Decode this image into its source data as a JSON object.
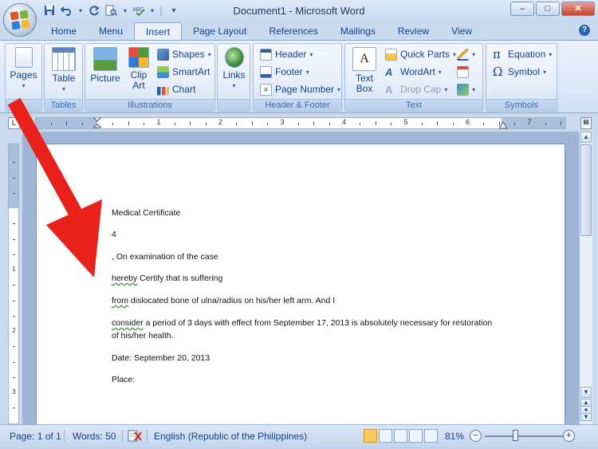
{
  "window": {
    "title": "Document1 - Microsoft Word",
    "controls": {
      "minimize": "–",
      "maximize": "□",
      "close": "✕"
    }
  },
  "quick_access": [
    {
      "name": "save-icon",
      "glyph": "💾"
    },
    {
      "name": "undo-icon",
      "glyph": "↶"
    },
    {
      "name": "redo-icon",
      "glyph": "↻"
    },
    {
      "name": "print-preview-icon",
      "glyph": "▤"
    },
    {
      "name": "spelling-icon",
      "glyph": "✓"
    },
    {
      "name": "customize-icon",
      "glyph": "▾"
    }
  ],
  "tabs": [
    "Home",
    "Menu",
    "Insert",
    "Page Layout",
    "References",
    "Mailings",
    "Review",
    "View"
  ],
  "active_tab": "Insert",
  "help_label": "?",
  "ribbon": {
    "pages": {
      "label": "Pages",
      "group": ""
    },
    "tables": {
      "table": "Table",
      "group": "Tables"
    },
    "illustrations": {
      "picture": "Picture",
      "clip_art_line1": "Clip",
      "clip_art_line2": "Art",
      "shapes": "Shapes",
      "smartart": "SmartArt",
      "chart": "Chart",
      "group": "Illustrations"
    },
    "links": {
      "label": "Links",
      "group": ""
    },
    "header_footer": {
      "header": "Header",
      "footer": "Footer",
      "page_number": "Page Number",
      "group": "Header & Footer"
    },
    "text": {
      "text_box_line1": "Text",
      "text_box_line2": "Box",
      "quick_parts": "Quick Parts",
      "wordart": "WordArt",
      "drop_cap": "Drop Cap",
      "group": "Text"
    },
    "symbols": {
      "equation": "Equation",
      "symbol": "Symbol",
      "group": "Symbols"
    }
  },
  "ruler": {
    "numbers": [
      "1",
      "2",
      "3",
      "4",
      "5",
      "6",
      "7"
    ],
    "vnumbers": [
      "1",
      "2",
      "3"
    ],
    "tab_selector": "L"
  },
  "document": {
    "lines": [
      {
        "text": "Medical Certificate"
      },
      {
        "text": "4"
      },
      {
        "text": ", On examination of the case"
      },
      {
        "squiggle": "hereby",
        "text": " Certify that is suffering"
      },
      {
        "squiggle": "from",
        "text": " dislocated bone of ulna/radius on his/her left arm. And I"
      },
      {
        "squiggle": "consider",
        "text": " a period of 3 days with effect from September 17, 2013 is absolutely necessary for restoration"
      },
      {
        "text": "of his/her health."
      },
      {
        "text": "Date: September 20, 2013"
      },
      {
        "text": "Place:"
      }
    ]
  },
  "statusbar": {
    "page": "Page: 1 of 1",
    "words": "Words: 50",
    "language": "English (Republic of the Philippines)",
    "zoom": "81%",
    "zoom_level": 0.81
  },
  "colors": {
    "arrow": "#e8221b",
    "accent": "#15428b"
  }
}
